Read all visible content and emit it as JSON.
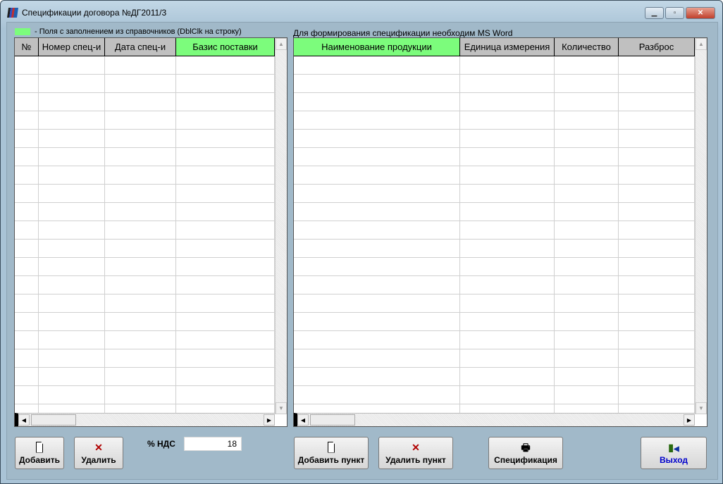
{
  "window": {
    "title": "Спецификации договора №ДГ2011/3",
    "controls": [
      "minimize",
      "maximize",
      "close"
    ]
  },
  "legend": {
    "text": "-  Поля с заполнением из справочников (DblClk на строку)",
    "color": "#7cfc7c"
  },
  "note": "Для формирования спецификации необходим MS Word",
  "left_grid": {
    "columns": [
      {
        "label": "№"
      },
      {
        "label": "Номер спец-и"
      },
      {
        "label": "Дата спец-и"
      },
      {
        "label": "Базис поставки",
        "lookup": true
      }
    ],
    "rows": []
  },
  "right_grid": {
    "columns": [
      {
        "label": "Наименование продукции",
        "lookup": true
      },
      {
        "label": "Единица измерения"
      },
      {
        "label": "Количество"
      },
      {
        "label": "Разброс"
      }
    ],
    "rows": []
  },
  "buttons": {
    "add": "Добавить",
    "delete": "Удалить",
    "add_item": "Добавить пункт",
    "delete_item": "Удалить пункт",
    "spec": "Спецификация",
    "exit": "Выход"
  },
  "vat": {
    "label": "% НДС",
    "value": "18"
  },
  "colors": {
    "exit_text": "#0000cc",
    "delete_icon": "#b00000"
  }
}
